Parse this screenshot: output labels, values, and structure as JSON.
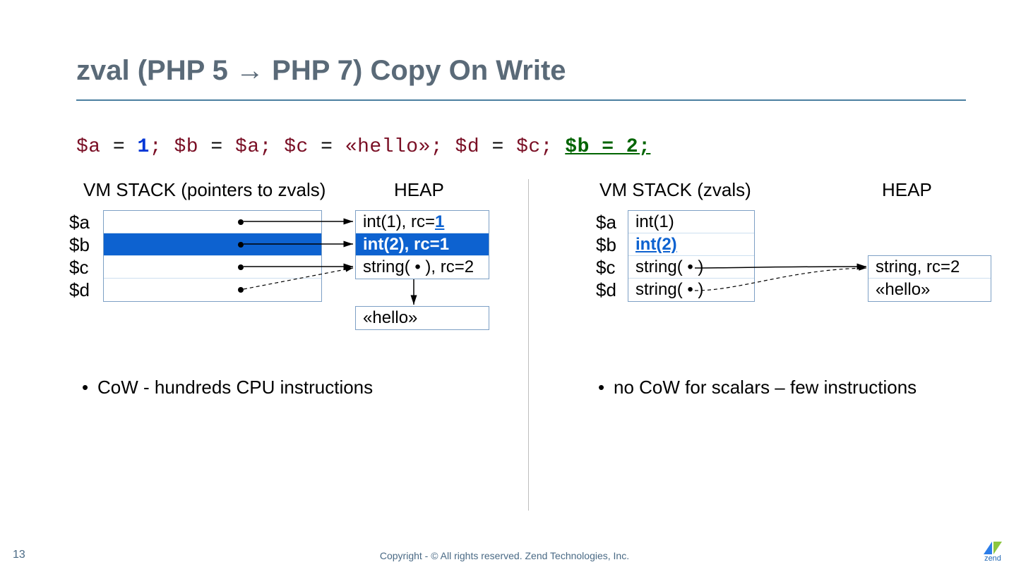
{
  "title": "zval (PHP 5 → PHP 7) Copy On Write",
  "code": {
    "segments": [
      {
        "cls": "var",
        "t": "$a"
      },
      {
        "cls": "op",
        "t": " "
      },
      {
        "cls": "eq",
        "t": "="
      },
      {
        "cls": "op",
        "t": " "
      },
      {
        "cls": "num",
        "t": "1"
      },
      {
        "cls": "semi",
        "t": "; "
      },
      {
        "cls": "var",
        "t": "$b"
      },
      {
        "cls": "op",
        "t": " "
      },
      {
        "cls": "eq",
        "t": "="
      },
      {
        "cls": "op",
        "t": " "
      },
      {
        "cls": "var",
        "t": "$a"
      },
      {
        "cls": "semi",
        "t": "; "
      },
      {
        "cls": "var",
        "t": "$c"
      },
      {
        "cls": "op",
        "t": " "
      },
      {
        "cls": "eq",
        "t": "="
      },
      {
        "cls": "op",
        "t": " "
      },
      {
        "cls": "str",
        "t": "«hello»"
      },
      {
        "cls": "semi",
        "t": "; "
      },
      {
        "cls": "var",
        "t": "$d"
      },
      {
        "cls": "op",
        "t": " "
      },
      {
        "cls": "eq",
        "t": "="
      },
      {
        "cls": "op",
        "t": " "
      },
      {
        "cls": "var",
        "t": "$c"
      },
      {
        "cls": "semi",
        "t": "; "
      },
      {
        "cls": "last",
        "t": "$b = 2;"
      }
    ]
  },
  "left": {
    "stack_header": "VM STACK (pointers to zvals)",
    "heap_header": "HEAP",
    "vars": [
      "$a",
      "$b",
      "$c",
      "$d"
    ],
    "heap_rows": {
      "r0_a": "int(1), rc=",
      "r0_b": "1",
      "r1": "int(2), rc=1",
      "r2": "string( • ), rc=2"
    },
    "hello": "«hello»",
    "bullet": "CoW - hundreds CPU instructions"
  },
  "right": {
    "stack_header": "VM STACK (zvals)",
    "heap_header": "HEAP",
    "vars": [
      "$a",
      "$b",
      "$c",
      "$d"
    ],
    "stack_rows": {
      "r0": "int(1)",
      "r1": "int(2)",
      "r2": "string( • )",
      "r3": "string( • )"
    },
    "heap_rows": {
      "r0": "string, rc=2",
      "r1": "«hello»"
    },
    "bullet": "no CoW for scalars – few instructions"
  },
  "footer": "Copyright - © All rights reserved. Zend Technologies, Inc.",
  "page": "13",
  "logo": "zend"
}
